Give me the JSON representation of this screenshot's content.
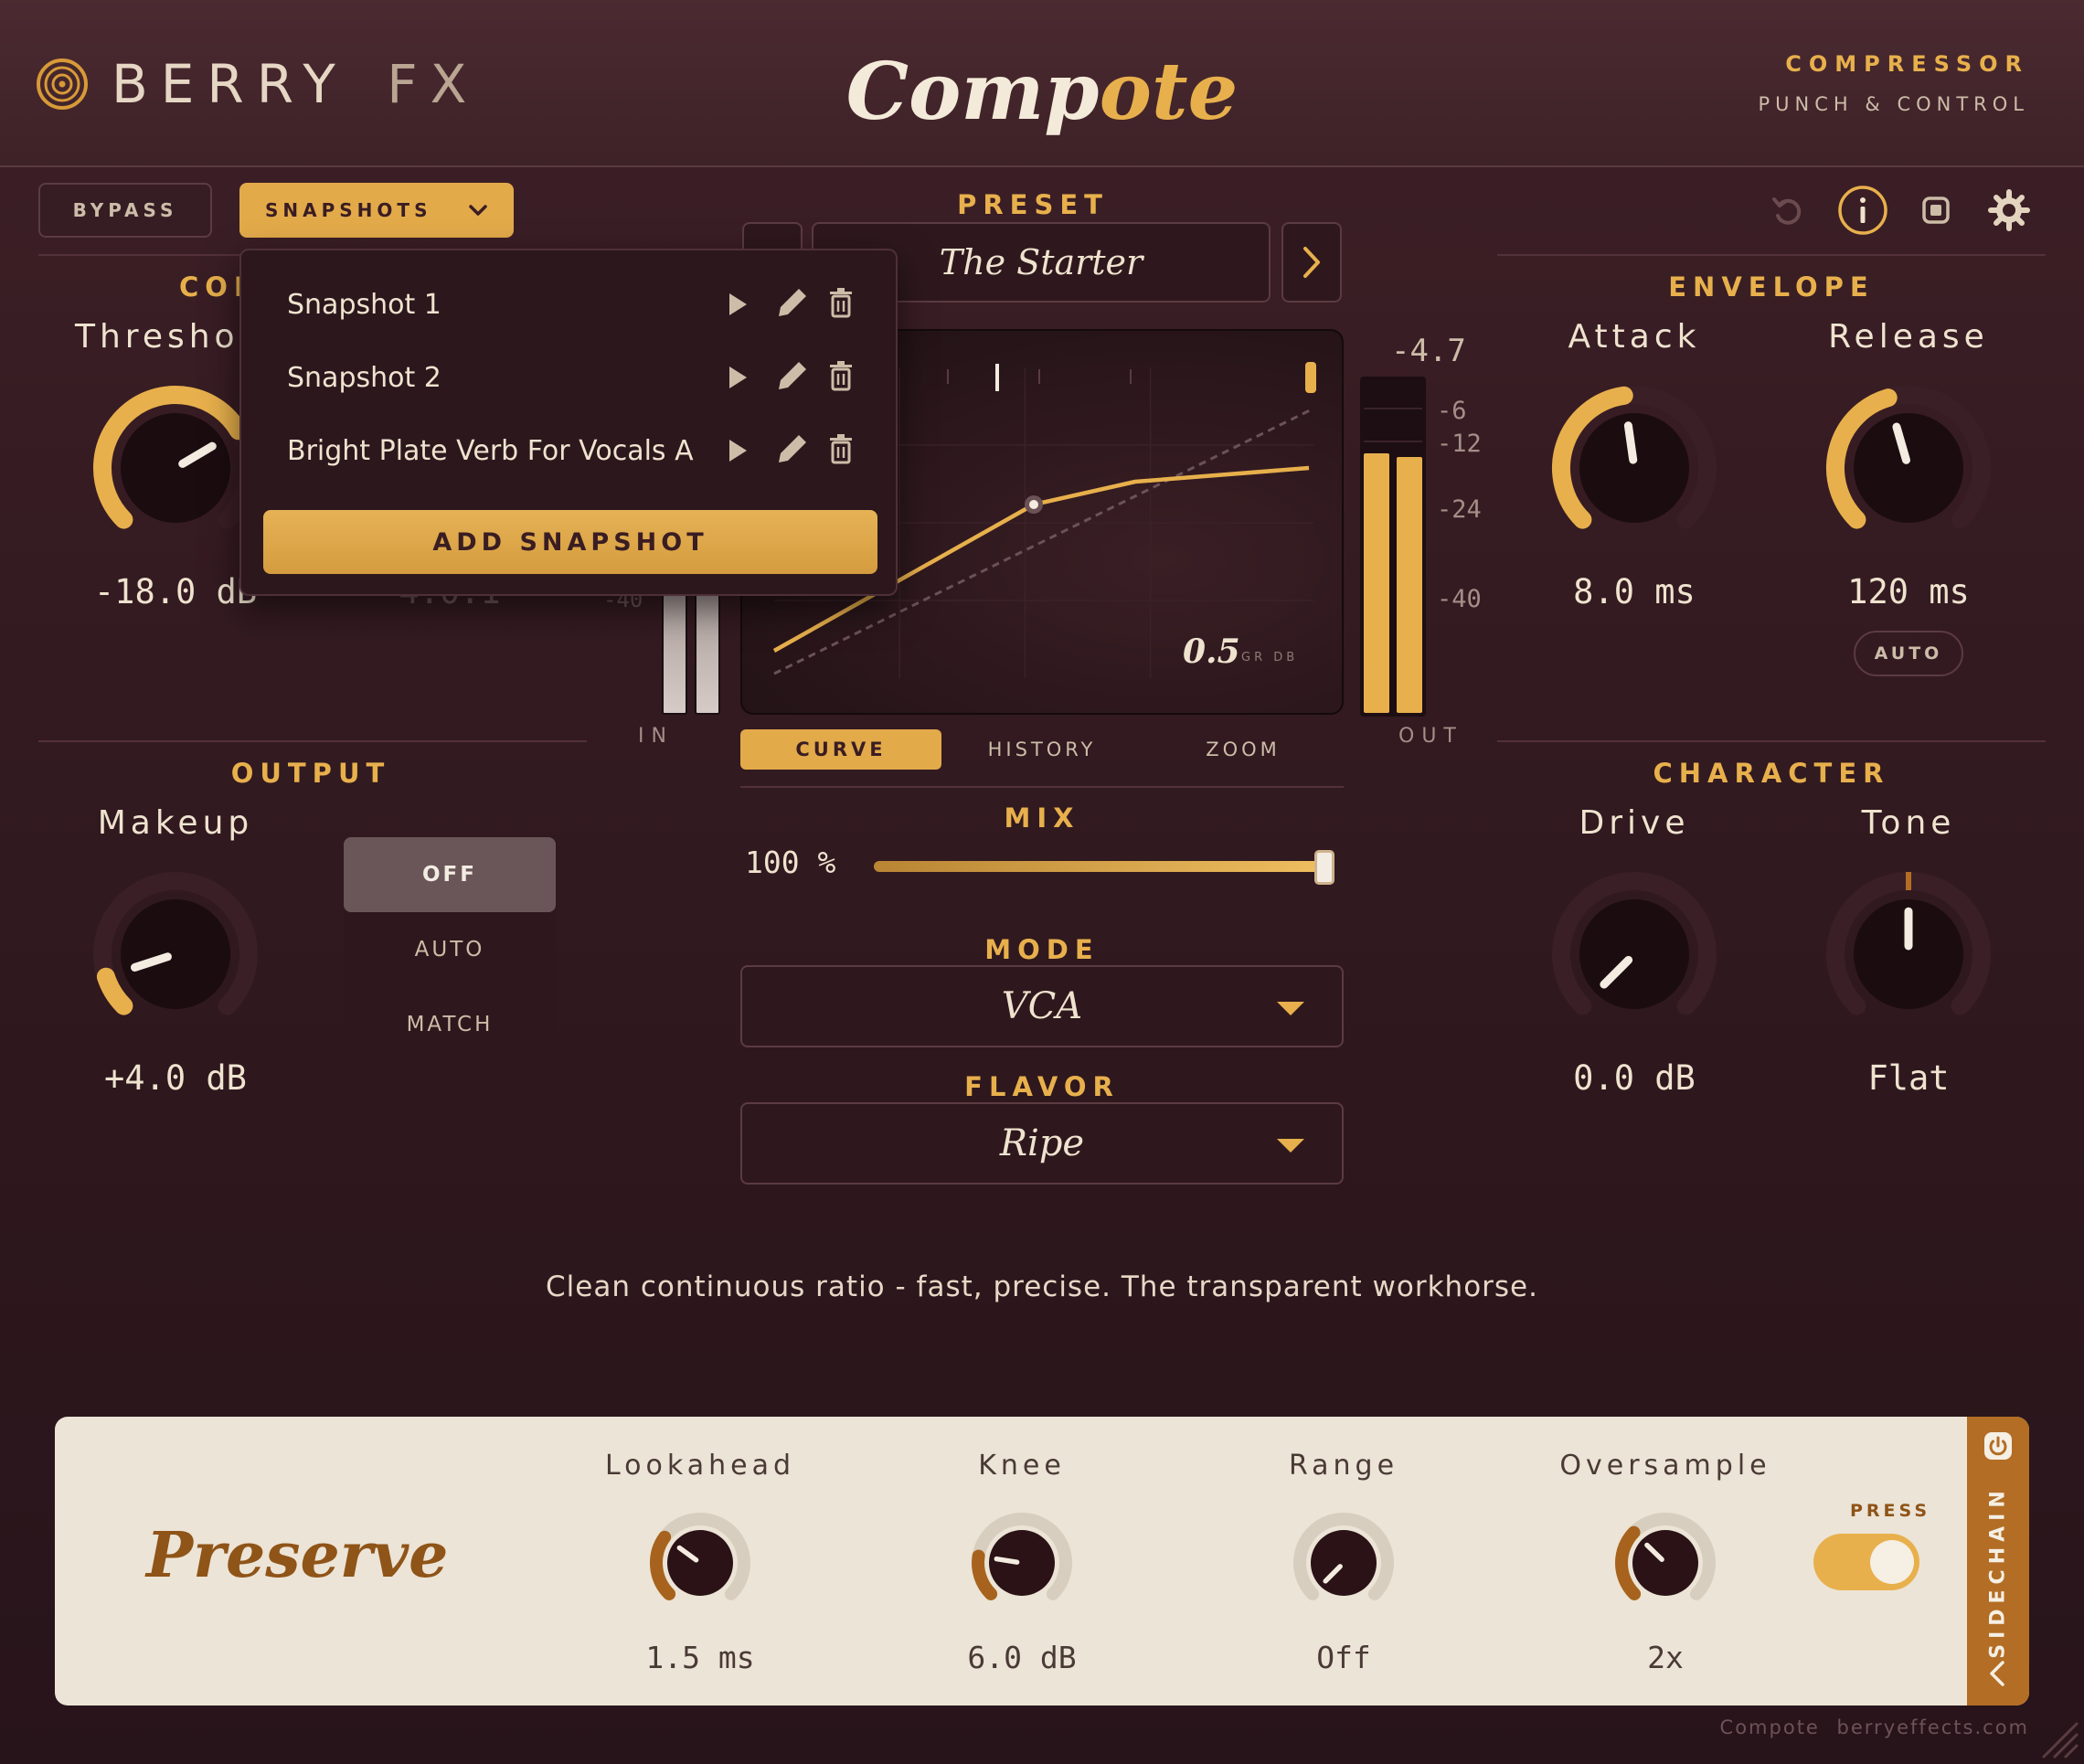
{
  "brand": {
    "name_part1": "BERRY",
    "name_part2": "FX",
    "logo_icon": "berry-spiral-logo"
  },
  "title": {
    "part1": "Comp",
    "part2": "ote"
  },
  "category": {
    "type": "COMPRESSOR",
    "tagline": "PUNCH & CONTROL"
  },
  "toolbar": {
    "bypass_label": "BYPASS",
    "snapshots_label": "SNAPSHOTS",
    "icons": [
      "undo-icon",
      "info-icon",
      "record-icon",
      "settings-icon"
    ]
  },
  "preset": {
    "label": "PRESET",
    "name": "The Starter"
  },
  "snapshots_menu": {
    "items": [
      {
        "name": "Snapshot 1"
      },
      {
        "name": "Snapshot 2"
      },
      {
        "name": "Bright Plate Verb For Vocals A"
      }
    ],
    "add_label": "ADD SNAPSHOT"
  },
  "comp_section": {
    "title_partial": "CON",
    "threshold_label_partial": "Threshol",
    "threshold_value": "-18.0 dB",
    "ratio_value_partial": "4.0:1",
    "threshold_fraction": 0.72
  },
  "meters": {
    "in_label": "IN",
    "out_label": "OUT",
    "out_peak": "-4.7",
    "scale": [
      "-6",
      "-12",
      "-24",
      "-40"
    ],
    "in_scale_partial": "-40",
    "gr_value": "0.5",
    "gr_unit": "GR DB",
    "out_level_left": 0.78,
    "out_level_right": 0.77
  },
  "graph_tabs": [
    "CURVE",
    "HISTORY",
    "ZOOM"
  ],
  "active_graph_tab": "CURVE",
  "mix": {
    "label": "MIX",
    "value": "100 %",
    "fraction": 1.0
  },
  "mode": {
    "label": "MODE",
    "value": "VCA"
  },
  "flavor": {
    "label": "FLAVOR",
    "value": "Ripe"
  },
  "description": "Clean continuous ratio - fast, precise. The transparent workhorse.",
  "envelope": {
    "title": "ENVELOPE",
    "attack": {
      "label": "Attack",
      "value": "8.0 ms",
      "fraction": 0.47
    },
    "release": {
      "label": "Release",
      "value": "120 ms",
      "fraction": 0.44,
      "auto_label": "AUTO"
    }
  },
  "output": {
    "title": "OUTPUT",
    "makeup": {
      "label": "Makeup",
      "value": "+4.0 dB",
      "fraction": 0.1
    },
    "gain_modes": [
      "OFF",
      "AUTO",
      "MATCH"
    ],
    "active_gain_mode": "OFF"
  },
  "character": {
    "title": "CHARACTER",
    "drive": {
      "label": "Drive",
      "value": "0.0 dB",
      "fraction": 0.0
    },
    "tone": {
      "label": "Tone",
      "value": "Flat",
      "fraction": 0.5
    }
  },
  "preserve": {
    "title": "Preserve",
    "lookahead": {
      "label": "Lookahead",
      "value": "1.5 ms",
      "fraction": 0.3
    },
    "knee": {
      "label": "Knee",
      "value": "6.0 dB",
      "fraction": 0.2
    },
    "range": {
      "label": "Range",
      "value": "Off",
      "fraction": 0.0
    },
    "oversample": {
      "label": "Oversample",
      "value": "2x",
      "fraction": 0.33
    },
    "press_label": "PRESS",
    "press_on": true
  },
  "sidechain": {
    "label": "SIDECHAIN"
  },
  "footer": {
    "product": "Compote",
    "site": "berryeffects.com"
  },
  "colors": {
    "accent": "#e8b04c",
    "bg": "#321a20",
    "panel_light": "#ece4d6",
    "preserve_brown": "#8f5418"
  }
}
